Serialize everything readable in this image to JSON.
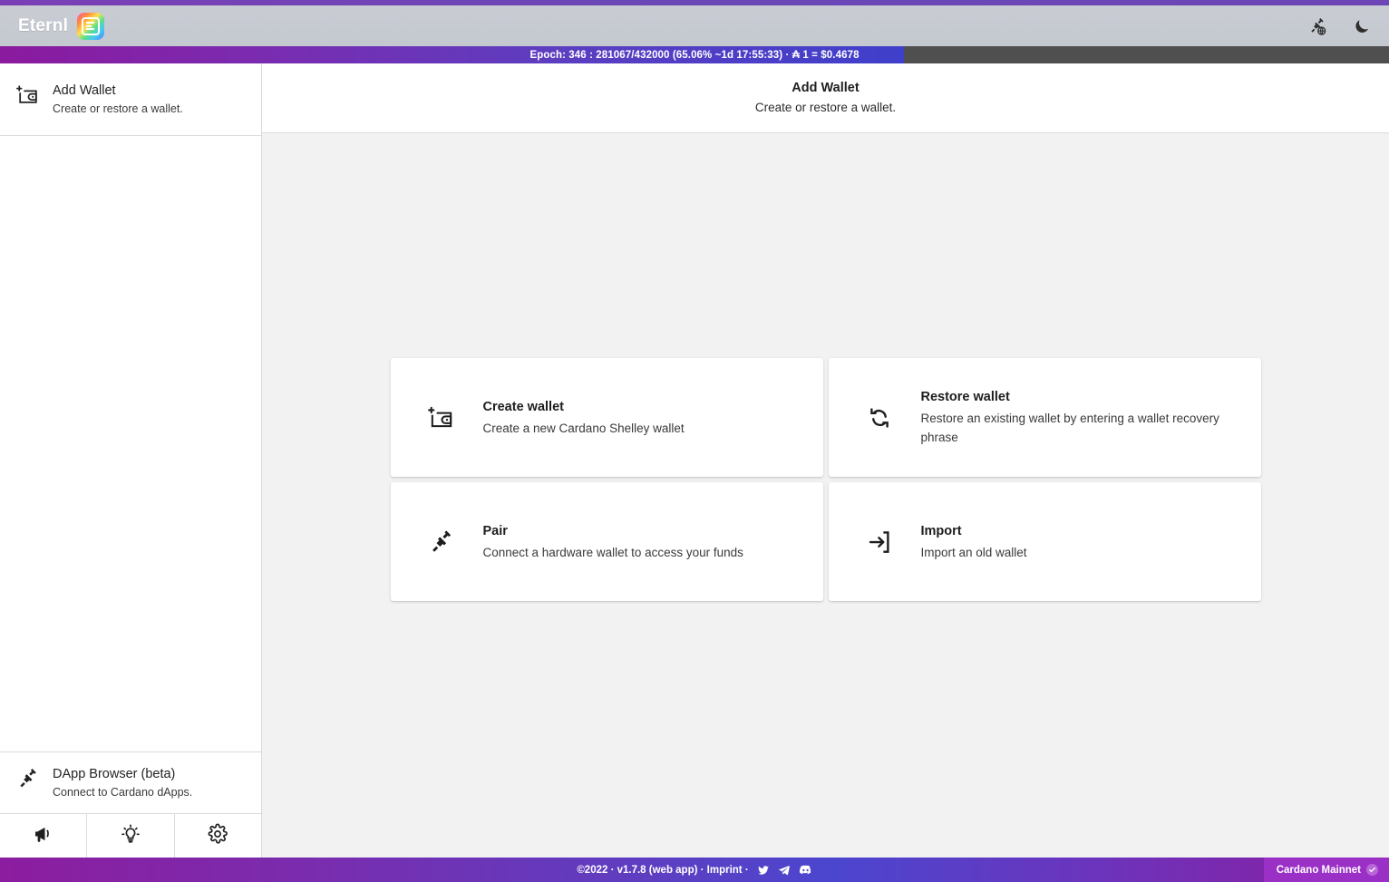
{
  "header": {
    "brand_name": "Eternl",
    "logo_icon": "eternl-logo",
    "actions": [
      {
        "icon": "dapp-connector-icon",
        "name": "dapp-connector-button"
      },
      {
        "icon": "moon-icon",
        "name": "dark-mode-toggle"
      }
    ]
  },
  "epoch": {
    "text": "Epoch: 346 : 281067/432000 (65.06%  ~1d 17:55:33) · ₳ 1 = $0.4678",
    "epoch_number": "346",
    "slot_current": "281067",
    "slot_total": "432000",
    "percent": "65.06%",
    "time_remaining": "~1d 17:55:33",
    "ada_price": "$0.4678",
    "progress_percent": 65.06,
    "fill_color_start": "#8a1a9e",
    "fill_color_end": "#3f3fcb",
    "track_color": "#4f4f4f"
  },
  "sidebar": {
    "wallet_entry": {
      "icon": "add-wallet-icon",
      "title": "Add Wallet",
      "subtitle": "Create or restore a wallet."
    },
    "dapp_entry": {
      "icon": "plug-icon",
      "title": "DApp Browser (beta)",
      "subtitle": "Connect to Cardano dApps."
    },
    "tools": [
      {
        "icon": "megaphone-icon",
        "name": "announcements-button"
      },
      {
        "icon": "lightbulb-icon",
        "name": "tips-button"
      },
      {
        "icon": "gear-icon",
        "name": "settings-button"
      }
    ]
  },
  "content": {
    "title": "Add Wallet",
    "subtitle": "Create or restore a wallet.",
    "cards": [
      {
        "icon": "add-wallet-icon",
        "title": "Create wallet",
        "subtitle": "Create a new Cardano Shelley wallet"
      },
      {
        "icon": "refresh-icon",
        "title": "Restore wallet",
        "subtitle": "Restore an existing wallet by entering a wallet recovery phrase"
      },
      {
        "icon": "plug-icon",
        "title": "Pair",
        "subtitle": "Connect a hardware wallet to access your funds"
      },
      {
        "icon": "import-icon",
        "title": "Import",
        "subtitle": "Import an old wallet"
      }
    ]
  },
  "footer": {
    "copyright": "©2022 · v1.7.8 (web app) · Imprint ·",
    "socials": [
      {
        "icon": "twitter-icon",
        "name": "twitter-link"
      },
      {
        "icon": "telegram-icon",
        "name": "telegram-link"
      },
      {
        "icon": "discord-icon",
        "name": "discord-link"
      }
    ],
    "network": "Cardano Mainnet",
    "network_badge_icon": "check-circle-icon",
    "background_accent": "#9b30c7"
  }
}
